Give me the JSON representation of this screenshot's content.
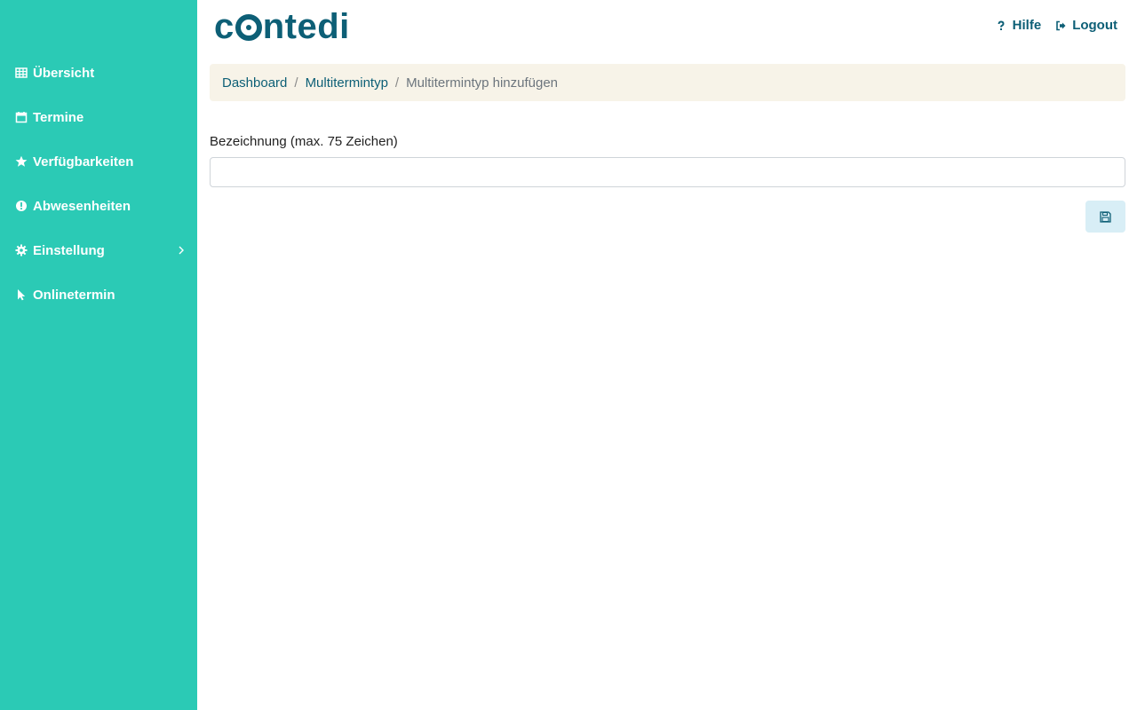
{
  "app": {
    "logo_text_pre": "c",
    "logo_text_post": "ntedi"
  },
  "colors": {
    "sidebar": "#2bcab5",
    "brand": "#0d5f76",
    "breadcrumb_bg": "#f7f3e8",
    "save_bg": "#d8eef6"
  },
  "sidebar": {
    "items": [
      {
        "label": "Übersicht",
        "icon": "table-icon"
      },
      {
        "label": "Termine",
        "icon": "calendar-icon"
      },
      {
        "label": "Verfügbarkeiten",
        "icon": "star-icon"
      },
      {
        "label": "Abwesenheiten",
        "icon": "exclamation-circle-icon"
      },
      {
        "label": "Einstellung",
        "icon": "gear-icon",
        "has_submenu": true
      },
      {
        "label": "Onlinetermin",
        "icon": "pointer-icon"
      }
    ]
  },
  "header": {
    "help_label": "Hilfe",
    "logout_label": "Logout"
  },
  "breadcrumb": {
    "items": [
      "Dashboard",
      "Multitermintyp",
      "Multitermintyp hinzufügen"
    ],
    "separator": "/"
  },
  "form": {
    "name_label": "Bezeichnung (max. 75 Zeichen)",
    "name_value": "",
    "save_icon": "floppy-disk-icon"
  }
}
